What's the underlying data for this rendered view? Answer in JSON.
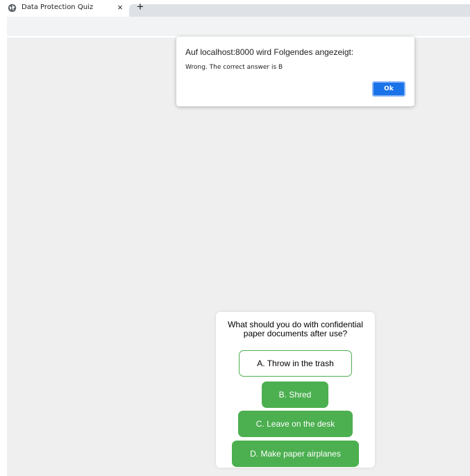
{
  "browser": {
    "tab_title": "Data Protection Quiz",
    "tab_close_label": "×",
    "new_tab_label": "+"
  },
  "dialog": {
    "title": "Auf localhost:8000 wird Folgendes angezeigt:",
    "message": "Wrong. The correct answer is B",
    "ok_label": "Ok"
  },
  "quiz": {
    "question": "What should you do with confidential paper documents after use?",
    "answers": [
      {
        "label": "A. Throw in the trash",
        "style": "outline"
      },
      {
        "label": "B. Shred",
        "style": "filled"
      },
      {
        "label": "C. Leave on the desk",
        "style": "filled"
      },
      {
        "label": "D. Make paper airplanes",
        "style": "filled"
      }
    ]
  },
  "colors": {
    "accent_green": "#4caf50",
    "dialog_button_blue": "#1a73e8",
    "page_background": "#efefef"
  }
}
